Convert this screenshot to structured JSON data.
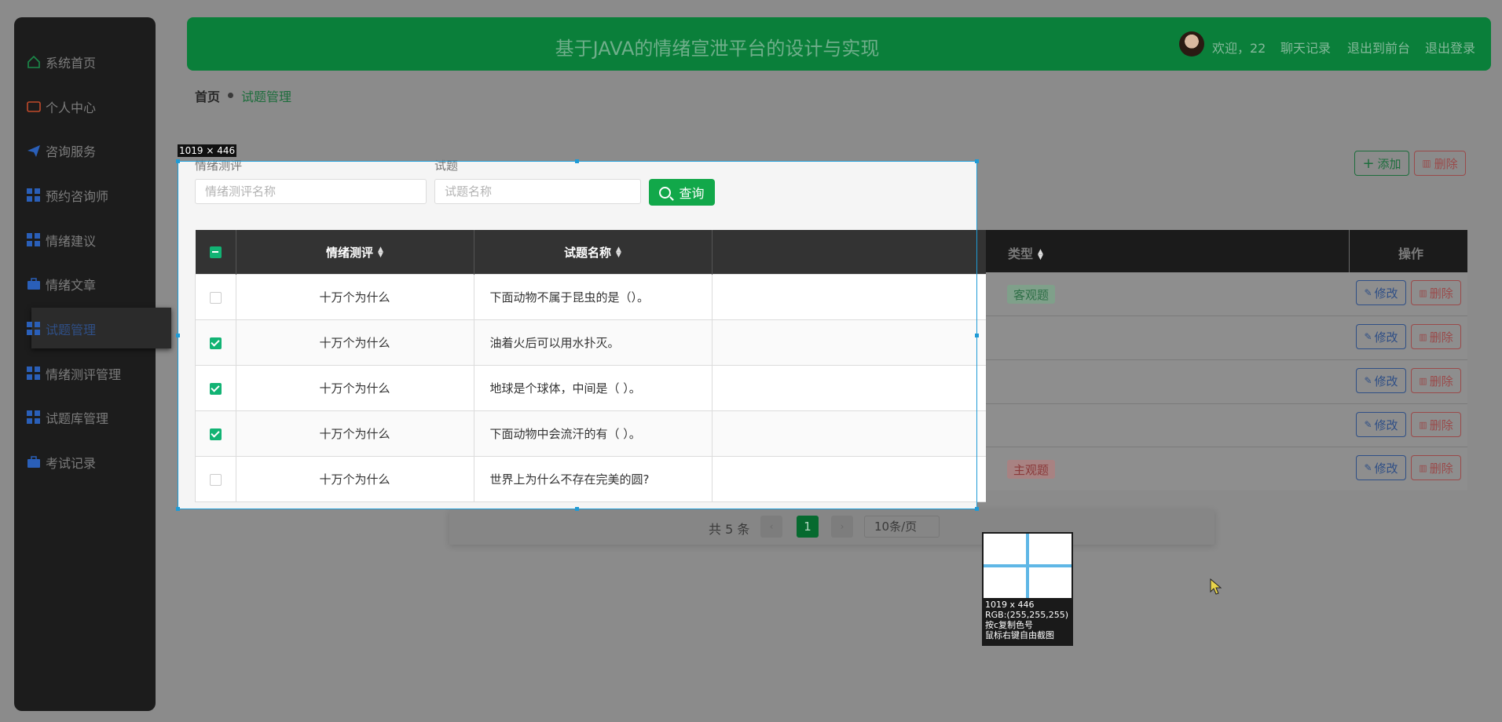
{
  "sidebar": {
    "items": [
      {
        "label": "系统首页",
        "icon": "home-icon"
      },
      {
        "label": "个人中心",
        "icon": "wallet-icon"
      },
      {
        "label": "咨询服务",
        "icon": "paper-plane-icon"
      },
      {
        "label": "预约咨询师",
        "icon": "grid-icon"
      },
      {
        "label": "情绪建议",
        "icon": "grid-icon"
      },
      {
        "label": "情绪文章",
        "icon": "briefcase-icon"
      },
      {
        "label": "试题管理",
        "icon": "grid-icon"
      },
      {
        "label": "情绪测评管理",
        "icon": "grid-icon"
      },
      {
        "label": "试题库管理",
        "icon": "grid-icon"
      },
      {
        "label": "考试记录",
        "icon": "briefcase-icon"
      }
    ]
  },
  "header": {
    "title": "基于JAVA的情绪宣泄平台的设计与实现",
    "welcome": "欢迎，22",
    "links": [
      "聊天记录",
      "退出到前台",
      "退出登录"
    ]
  },
  "breadcrumb": {
    "home": "首页",
    "current": "试题管理"
  },
  "toolbar": {
    "add": "添加",
    "delete": "删除"
  },
  "search": {
    "label1": "情绪测评",
    "placeholder1": "情绪测评名称",
    "label2": "试题",
    "placeholder2": "试题名称",
    "query": "查询"
  },
  "table": {
    "headers": [
      "情绪测评",
      "试题名称",
      "类型",
      "操作"
    ],
    "rows": [
      {
        "checked": false,
        "eval": "十万个为什么",
        "name": "下面动物不属于昆虫的是（）。",
        "type": "客观题"
      },
      {
        "checked": true,
        "eval": "十万个为什么",
        "name": "油着火后可以用水扑灭。",
        "type": ""
      },
      {
        "checked": true,
        "eval": "十万个为什么",
        "name": "地球是个球体，中间是（ ）。",
        "type": ""
      },
      {
        "checked": true,
        "eval": "十万个为什么",
        "name": "下面动物中会流汗的有（ ）。",
        "type": ""
      },
      {
        "checked": false,
        "eval": "十万个为什么",
        "name": "世界上为什么不存在完美的圆?",
        "type": "主观题"
      }
    ],
    "edit": "修改",
    "del": "删除"
  },
  "pager": {
    "total": "共 5 条",
    "page": "1",
    "size": "10条/页"
  },
  "capture": {
    "size": "1019 × 446",
    "info": [
      "1019 x 446",
      "RGB:(255,255,255)",
      "按c复制色号",
      "鼠标右键自由截图"
    ]
  },
  "colors": {
    "accent": "#12a84a",
    "header": "#0a7f3a",
    "selection": "#1f9bd6"
  }
}
